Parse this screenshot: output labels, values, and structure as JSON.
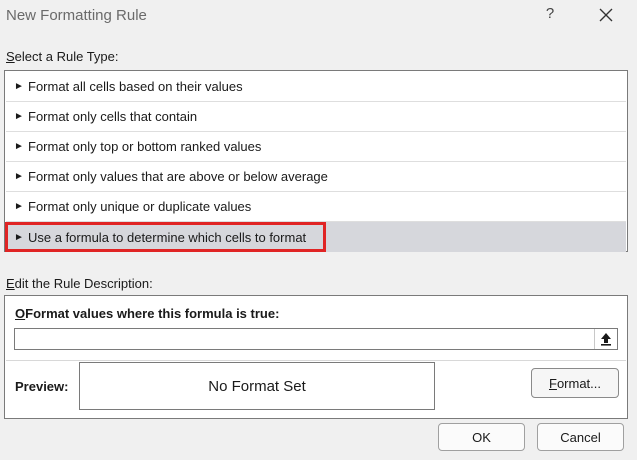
{
  "window": {
    "title": "New Formatting Rule",
    "help_glyph": "?"
  },
  "rule_type": {
    "heading_underlined": "S",
    "heading_rest": "elect a Rule Type:",
    "items": [
      {
        "label": "Format all cells based on their values"
      },
      {
        "label": "Format only cells that contain"
      },
      {
        "label": "Format only top or bottom ranked values"
      },
      {
        "label": "Format only values that are above or below average"
      },
      {
        "label": "Format only unique or duplicate values"
      },
      {
        "label": "Use a formula to determine which cells to format",
        "selected": true
      }
    ]
  },
  "description": {
    "heading_underlined": "E",
    "heading_rest": "dit the Rule Description:",
    "formula_label_underlined": "O",
    "formula_label_rest": "Format values where this formula is true:",
    "formula_value": "",
    "preview_label": "Preview:",
    "preview_text": "No Format Set",
    "format_button_underlined": "F",
    "format_button_rest": "ormat..."
  },
  "footer": {
    "ok_label": "OK",
    "cancel_label": "Cancel"
  },
  "colors": {
    "selection_background": "#d6d7dc",
    "highlight_outline": "#e02424"
  }
}
